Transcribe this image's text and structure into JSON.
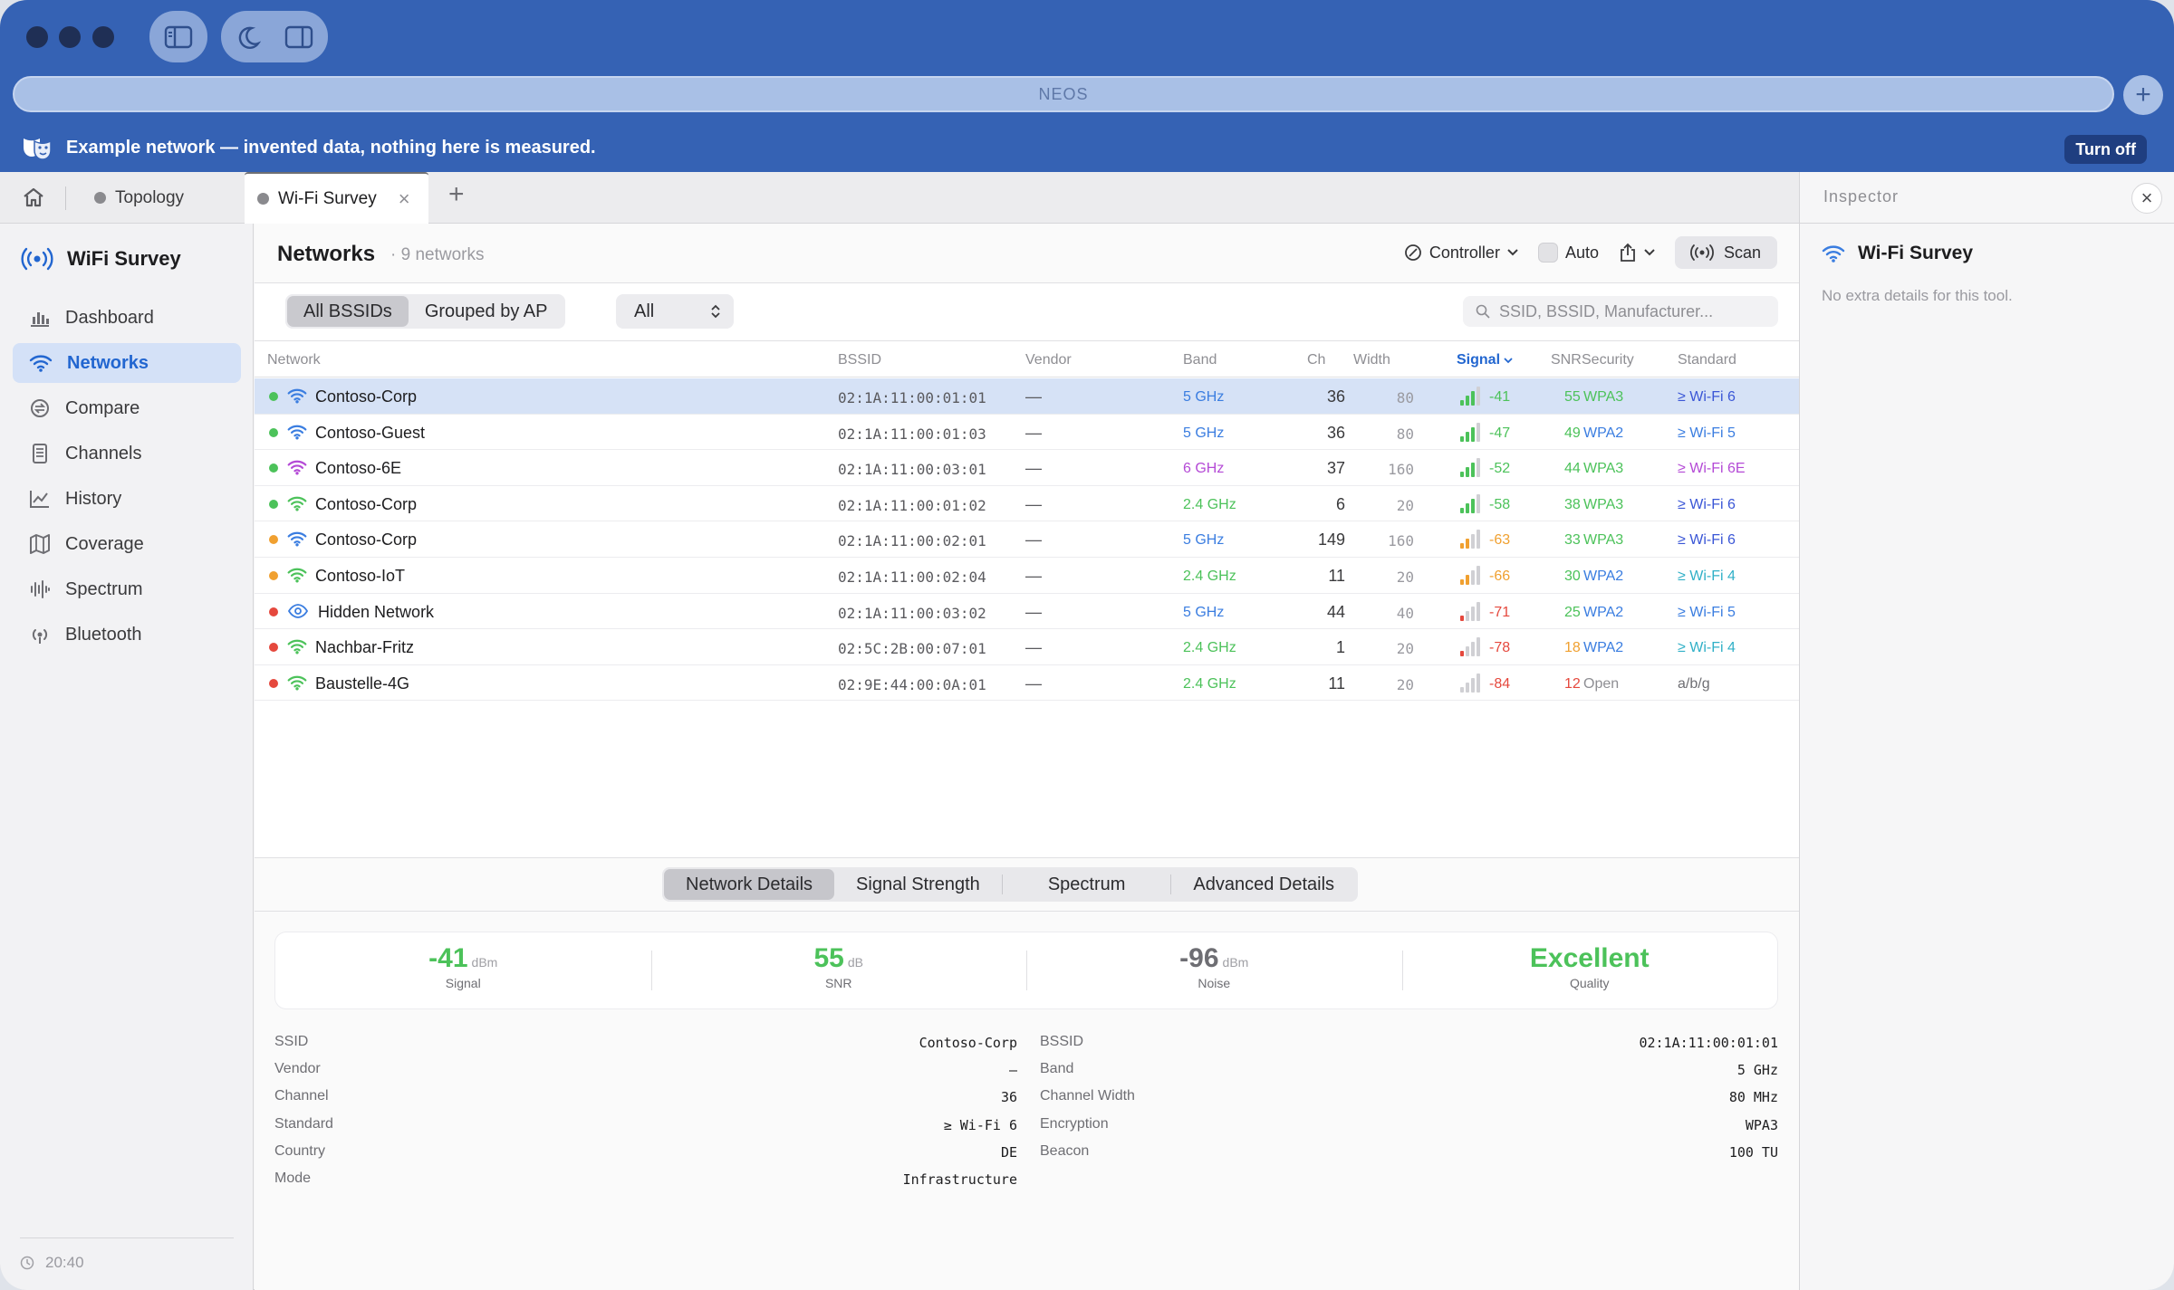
{
  "browser": {
    "url": "NEOS",
    "banner": {
      "text": "Example network — invented data, nothing here is measured.",
      "button": "Turn off"
    }
  },
  "tabs": [
    {
      "label": "Topology",
      "active": false
    },
    {
      "label": "Wi-Fi Survey",
      "active": true
    }
  ],
  "sidebar": {
    "title": "WiFi Survey",
    "items": [
      {
        "label": "Dashboard",
        "icon": "chart-bar-icon"
      },
      {
        "label": "Networks",
        "icon": "wifi-icon",
        "active": true
      },
      {
        "label": "Compare",
        "icon": "compare-icon"
      },
      {
        "label": "Channels",
        "icon": "channels-icon"
      },
      {
        "label": "History",
        "icon": "history-chart-icon"
      },
      {
        "label": "Coverage",
        "icon": "map-icon"
      },
      {
        "label": "Spectrum",
        "icon": "spectrum-icon"
      },
      {
        "label": "Bluetooth",
        "icon": "bluetooth-icon"
      }
    ],
    "footer_time": "20:40"
  },
  "toolbar": {
    "title": "Networks",
    "count": "9 networks",
    "controller": "Controller",
    "auto": "Auto",
    "scan": "Scan"
  },
  "filters": {
    "segments": [
      "All BSSIDs",
      "Grouped by AP"
    ],
    "selected_segment": "All BSSIDs",
    "band_select": "All",
    "search_placeholder": "SSID, BSSID, Manufacturer..."
  },
  "table": {
    "columns": [
      "Network",
      "BSSID",
      "Vendor",
      "Band",
      "Ch",
      "Width",
      "Signal",
      "SNR",
      "Security",
      "Standard"
    ],
    "sorted_column": "Signal",
    "rows": [
      {
        "status": "#4cc25a",
        "ssid": "Contoso-Corp",
        "bssid": "02:1A:11:00:01:01",
        "vendor": "—",
        "band": "5 GHz",
        "ch": "36",
        "width": "80",
        "bars": 3,
        "signal": "-41",
        "snr": "55",
        "security": "WPA3",
        "standard": "≥ Wi-Fi 6",
        "selected": true,
        "icon_color": "#3a7de0",
        "band_color": "#3a7de0",
        "sig_color": "#4cc25a",
        "snr_color": "#4cc25a",
        "sec_color": "#4cc25a",
        "std_color": "#3a56d6"
      },
      {
        "status": "#4cc25a",
        "ssid": "Contoso-Guest",
        "bssid": "02:1A:11:00:01:03",
        "vendor": "—",
        "band": "5 GHz",
        "ch": "36",
        "width": "80",
        "bars": 3,
        "signal": "-47",
        "snr": "49",
        "security": "WPA2",
        "standard": "≥ Wi-Fi 5",
        "icon_color": "#3a7de0",
        "band_color": "#3a7de0",
        "sig_color": "#4cc25a",
        "snr_color": "#4cc25a",
        "sec_color": "#3a7de0",
        "std_color": "#3a7de0"
      },
      {
        "status": "#4cc25a",
        "ssid": "Contoso-6E",
        "bssid": "02:1A:11:00:03:01",
        "vendor": "—",
        "band": "6 GHz",
        "ch": "37",
        "width": "160",
        "bars": 3,
        "signal": "-52",
        "snr": "44",
        "security": "WPA3",
        "standard": "≥ Wi-Fi 6E",
        "icon_color": "#b44ad6",
        "band_color": "#b44ad6",
        "sig_color": "#4cc25a",
        "snr_color": "#4cc25a",
        "sec_color": "#4cc25a",
        "std_color": "#b44ad6"
      },
      {
        "status": "#4cc25a",
        "ssid": "Contoso-Corp",
        "bssid": "02:1A:11:00:01:02",
        "vendor": "—",
        "band": "2.4 GHz",
        "ch": "6",
        "width": "20",
        "bars": 3,
        "signal": "-58",
        "snr": "38",
        "security": "WPA3",
        "standard": "≥ Wi-Fi 6",
        "icon_color": "#4cc25a",
        "band_color": "#4cc25a",
        "sig_color": "#4cc25a",
        "snr_color": "#4cc25a",
        "sec_color": "#4cc25a",
        "std_color": "#3a56d6"
      },
      {
        "status": "#f0a030",
        "ssid": "Contoso-Corp",
        "bssid": "02:1A:11:00:02:01",
        "vendor": "—",
        "band": "5 GHz",
        "ch": "149",
        "width": "160",
        "bars": 2,
        "signal": "-63",
        "snr": "33",
        "security": "WPA3",
        "standard": "≥ Wi-Fi 6",
        "icon_color": "#3a7de0",
        "band_color": "#3a7de0",
        "sig_color": "#f0a030",
        "snr_color": "#4cc25a",
        "sec_color": "#4cc25a",
        "std_color": "#3a56d6"
      },
      {
        "status": "#f0a030",
        "ssid": "Contoso-IoT",
        "bssid": "02:1A:11:00:02:04",
        "vendor": "—",
        "band": "2.4 GHz",
        "ch": "11",
        "width": "20",
        "bars": 2,
        "signal": "-66",
        "snr": "30",
        "security": "WPA2",
        "standard": "≥ Wi-Fi 4",
        "icon_color": "#4cc25a",
        "band_color": "#4cc25a",
        "sig_color": "#f0a030",
        "snr_color": "#4cc25a",
        "sec_color": "#3a7de0",
        "std_color": "#30b0c7"
      },
      {
        "status": "#e5483d",
        "ssid": "Hidden Network",
        "bssid": "02:1A:11:00:03:02",
        "vendor": "—",
        "band": "5 GHz",
        "ch": "44",
        "width": "40",
        "bars": 1,
        "signal": "-71",
        "snr": "25",
        "security": "WPA2",
        "standard": "≥ Wi-Fi 5",
        "hidden": true,
        "icon_color": "#3a7de0",
        "band_color": "#3a7de0",
        "sig_color": "#e5483d",
        "snr_color": "#4cc25a",
        "sec_color": "#3a7de0",
        "std_color": "#3a7de0"
      },
      {
        "status": "#e5483d",
        "ssid": "Nachbar-Fritz",
        "bssid": "02:5C:2B:00:07:01",
        "vendor": "—",
        "band": "2.4 GHz",
        "ch": "1",
        "width": "20",
        "bars": 1,
        "signal": "-78",
        "snr": "18",
        "security": "WPA2",
        "standard": "≥ Wi-Fi 4",
        "icon_color": "#4cc25a",
        "band_color": "#4cc25a",
        "sig_color": "#e5483d",
        "snr_color": "#f0a030",
        "sec_color": "#3a7de0",
        "std_color": "#30b0c7"
      },
      {
        "status": "#e5483d",
        "ssid": "Baustelle-4G",
        "bssid": "02:9E:44:00:0A:01",
        "vendor": "—",
        "band": "2.4 GHz",
        "ch": "11",
        "width": "20",
        "bars": 0,
        "signal": "-84",
        "snr": "12",
        "security": "Open",
        "standard": "a/b/g",
        "icon_color": "#4cc25a",
        "band_color": "#4cc25a",
        "sig_color": "#e5483d",
        "snr_color": "#e5483d",
        "sec_color": "#8e8e93",
        "std_color": "#6e6e73"
      }
    ]
  },
  "detail": {
    "tabs": [
      "Network Details",
      "Signal Strength",
      "Spectrum",
      "Advanced Details"
    ],
    "active_tab": "Network Details",
    "metrics": [
      {
        "value": "-41",
        "unit": "dBm",
        "label": "Signal",
        "color": "#4cc25a"
      },
      {
        "value": "55",
        "unit": "dB",
        "label": "SNR",
        "color": "#4cc25a"
      },
      {
        "value": "-96",
        "unit": "dBm",
        "label": "Noise",
        "color": "#6e6e73"
      },
      {
        "value": "Excellent",
        "unit": "",
        "label": "Quality",
        "color": "#4cc25a"
      }
    ],
    "left": [
      {
        "k": "SSID",
        "v": "Contoso-Corp"
      },
      {
        "k": "Vendor",
        "v": "—"
      },
      {
        "k": "Channel",
        "v": "36"
      },
      {
        "k": "Standard",
        "v": "≥ Wi-Fi 6"
      },
      {
        "k": "Country",
        "v": "DE"
      },
      {
        "k": "Mode",
        "v": "Infrastructure"
      }
    ],
    "right": [
      {
        "k": "BSSID",
        "v": "02:1A:11:00:01:01"
      },
      {
        "k": "Band",
        "v": "5 GHz"
      },
      {
        "k": "Channel Width",
        "v": "80 MHz"
      },
      {
        "k": "Encryption",
        "v": "WPA3"
      },
      {
        "k": "Beacon",
        "v": "100 TU"
      }
    ]
  },
  "inspector": {
    "title": "Inspector",
    "tool": "Wi-Fi Survey",
    "description": "No extra details for this tool."
  }
}
